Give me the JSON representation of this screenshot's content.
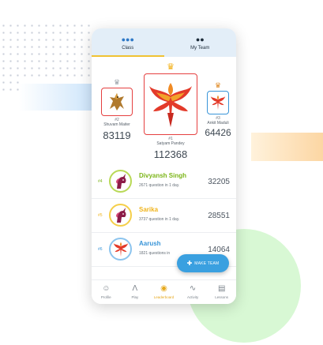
{
  "tabs": [
    {
      "label": "Class",
      "icon": "group-icon",
      "active": true
    },
    {
      "label": "My Team",
      "icon": "team-icon",
      "active": false
    }
  ],
  "podium": {
    "second": {
      "rank": "#2",
      "name": "Shuvam Maiter",
      "score": "83119",
      "avatar": "griffin-avatar"
    },
    "first": {
      "rank": "#1",
      "name": "Satyam Pandey",
      "score": "112368",
      "avatar": "phoenix-avatar"
    },
    "third": {
      "rank": "#3",
      "name": "Ankit Maduli",
      "score": "64426",
      "avatar": "phoenix-avatar"
    }
  },
  "leaderboard": [
    {
      "rank": "#4",
      "name": "Divyansh Singh",
      "questions": "2671 question in 1 day.",
      "score": "32205",
      "color": "#7cb518"
    },
    {
      "rank": "#5",
      "name": "Sarika",
      "questions": "3737 question in 1 day.",
      "score": "28551",
      "color": "#f0b41c"
    },
    {
      "rank": "#6",
      "name": "Aarush",
      "questions": "1821 questions in",
      "score": "14064",
      "color": "#3a95d8"
    }
  ],
  "fab": {
    "label": "MAKE TEAM",
    "icon": "add-person-icon"
  },
  "nav": [
    {
      "label": "Profile",
      "icon": "person-icon"
    },
    {
      "label": "Play",
      "icon": "play-icon"
    },
    {
      "label": "Leaderboard",
      "icon": "trophy-icon"
    },
    {
      "label": "Activity",
      "icon": "activity-icon"
    },
    {
      "label": "Lessons",
      "icon": "lessons-icon"
    }
  ],
  "colors": {
    "accent": "#f0c233",
    "primary": "#3aa0e0",
    "frame": "#e54040"
  }
}
